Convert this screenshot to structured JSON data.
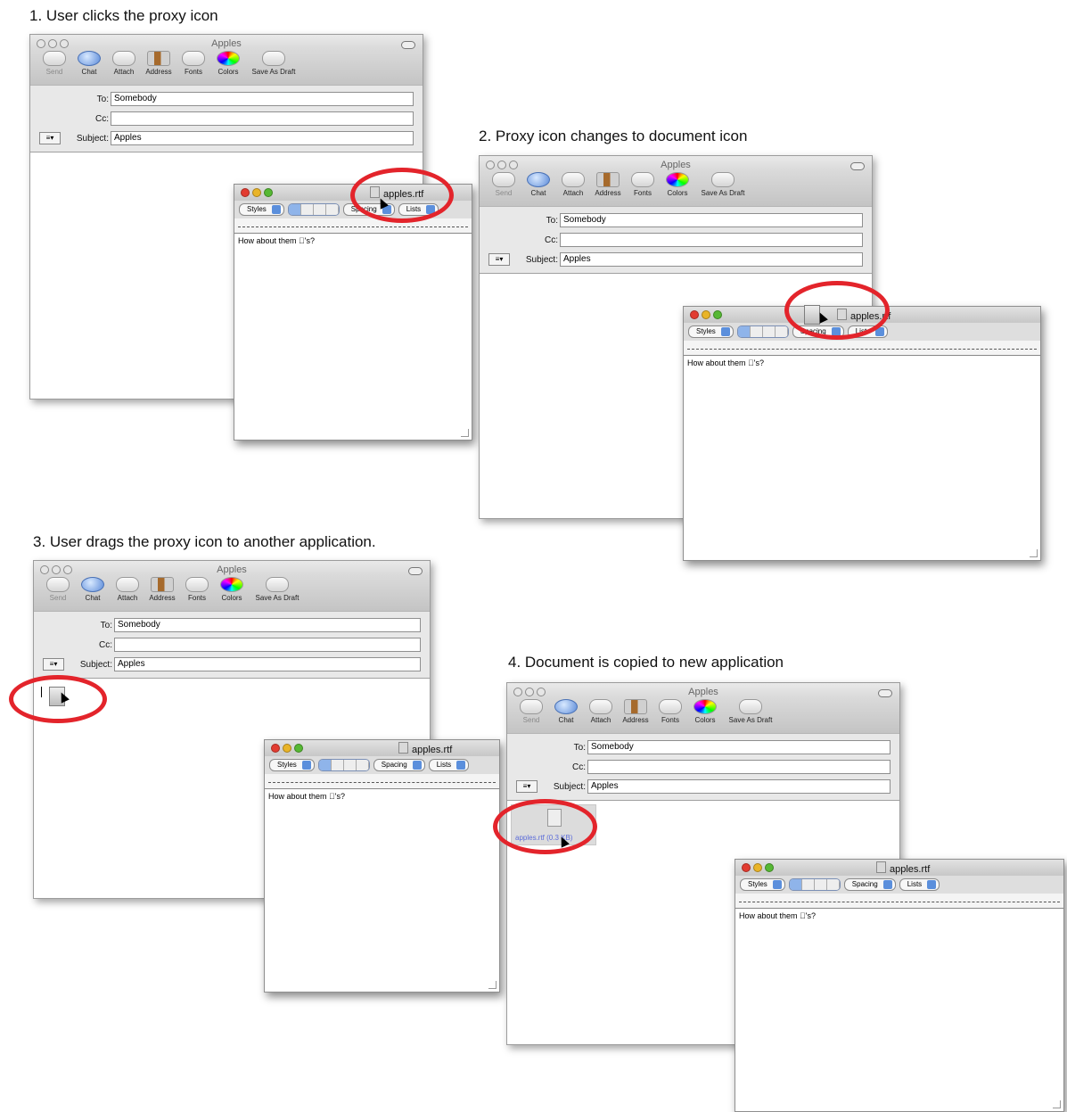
{
  "captions": {
    "step1": "1. User clicks the proxy icon",
    "step2": "2. Proxy icon changes to document icon",
    "step3": "3. User drags the proxy icon to another application.",
    "step4": "4. Document is copied to new application"
  },
  "mail": {
    "title": "Apples",
    "toolbar": [
      "Send",
      "Chat",
      "Attach",
      "Address",
      "Fonts",
      "Colors",
      "Save As Draft"
    ],
    "to_label": "To:",
    "to_value": "Somebody",
    "cc_label": "Cc:",
    "cc_value": "",
    "subject_label": "Subject:",
    "subject_value": "Apples",
    "account_icon": "≡▾"
  },
  "textedit": {
    "title": "apples.rtf",
    "styles_label": "Styles",
    "spacing_label": "Spacing",
    "lists_label": "Lists",
    "body_text": "How about them 's?",
    "body_text_plain": "How about them ",
    "body_text_suffix": "'s?"
  },
  "attachment_label": "apples.rtf (0.3 KB)",
  "colors": {
    "highlight": "#e3242b",
    "link": "#5b6cd9"
  }
}
